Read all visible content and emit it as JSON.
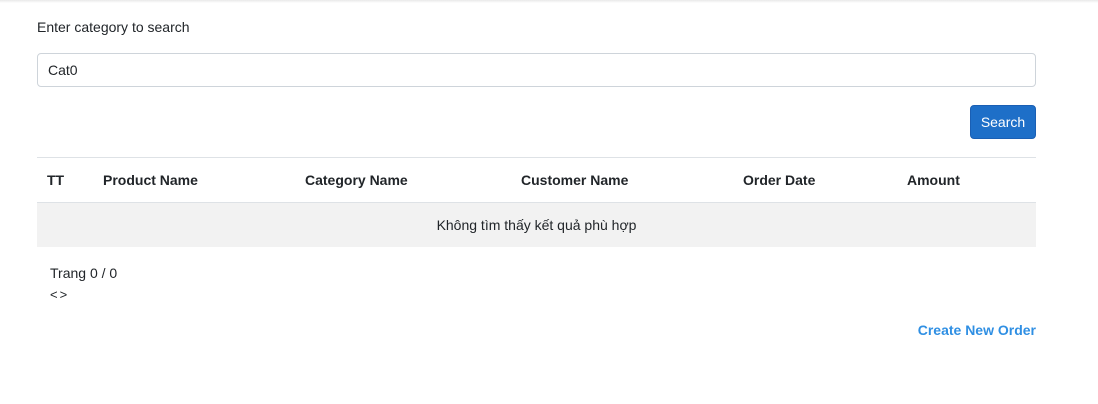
{
  "search": {
    "label": "Enter category to search",
    "value": "Cat0",
    "button_label": "Search"
  },
  "table": {
    "columns": [
      "TT",
      "Product Name",
      "Category Name",
      "Customer Name",
      "Order Date",
      "Amount"
    ],
    "empty_message": "Không tìm thấy kết quả phù hợp"
  },
  "pager": {
    "page_text": "Trang 0 / 0",
    "prev": "<",
    "next": ">"
  },
  "actions": {
    "create_label": "Create New Order"
  },
  "colors": {
    "primary": "#1e6fc8",
    "link": "#2f8fe3",
    "empty_row_bg": "#f2f2f2"
  }
}
